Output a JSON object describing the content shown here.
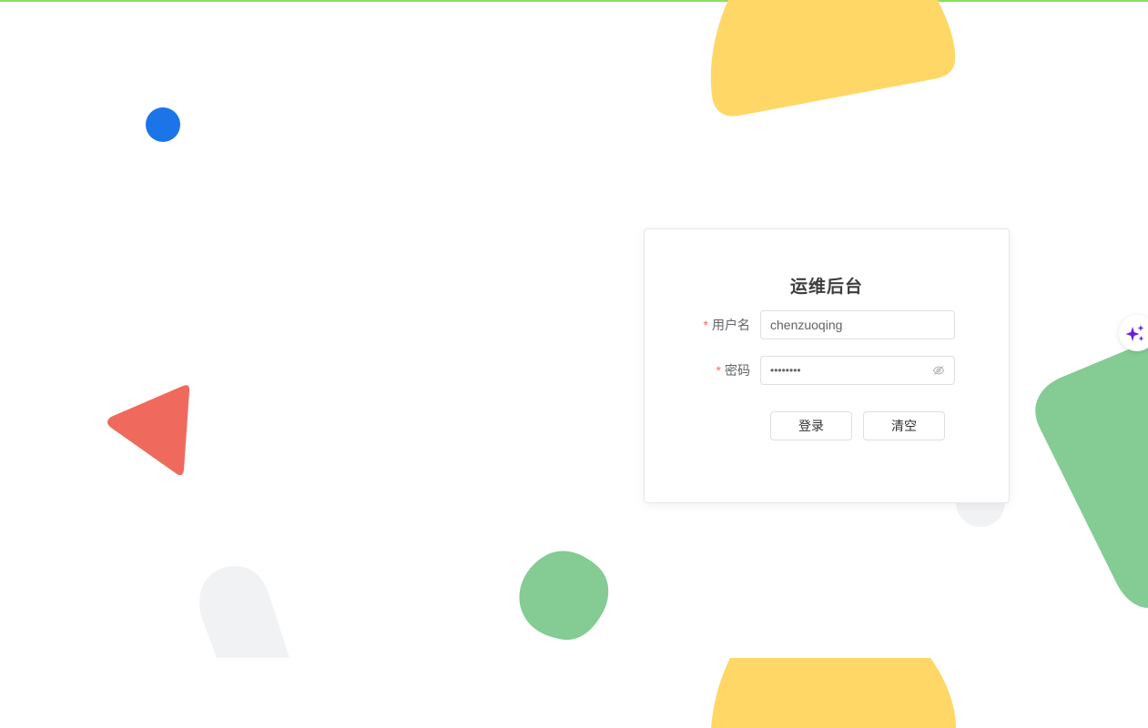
{
  "login": {
    "title": "运维后台",
    "username": {
      "required_mark": "*",
      "label": "用户名",
      "value": "chenzuoqing"
    },
    "password": {
      "required_mark": "*",
      "label": "密码",
      "masked_value": "••••••••",
      "toggle_icon": "eye-off-icon"
    },
    "login_button": "登录",
    "clear_button": "清空"
  },
  "floating": {
    "assistant_icon": "sparkle-icon"
  },
  "colors": {
    "yellow": "#fed766",
    "blue": "#1b74e8",
    "red": "#ef6a5d",
    "green": "#84cb94",
    "gray": "#f1f2f4",
    "required": "#f56c6c",
    "sparkle": "#6a1fd6"
  }
}
